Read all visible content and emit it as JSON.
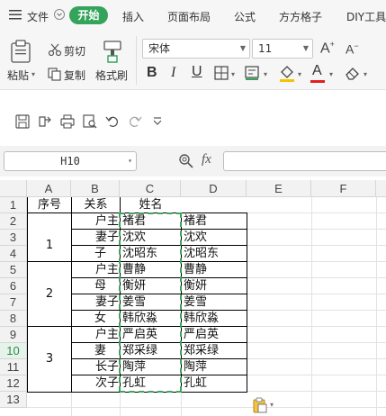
{
  "menu": {
    "file_label": "文件",
    "tabs": [
      "开始",
      "插入",
      "页面布局",
      "公式",
      "方方格子",
      "DIY工具"
    ]
  },
  "ribbon": {
    "paste_label": "粘贴",
    "cut_label": "剪切",
    "copy_label": "复制",
    "format_painter_label": "格式刷",
    "font_name": "宋体",
    "font_size": "11",
    "bold": "B",
    "italic": "I",
    "underline": "U",
    "font_color_letter": "A",
    "font_color": "#e02020",
    "fill_color": "#f5c400"
  },
  "formula_bar": {
    "name_box": "H10",
    "fx_label": "fx",
    "formula": ""
  },
  "sheet": {
    "columns": [
      "A",
      "B",
      "C",
      "D",
      "E",
      "F"
    ],
    "rows": [
      "1",
      "2",
      "3",
      "4",
      "5",
      "6",
      "7",
      "8",
      "9",
      "10",
      "11",
      "12",
      "13"
    ],
    "header_row": {
      "a": "序号",
      "b": "关系",
      "c": "姓名",
      "d": ""
    },
    "groups": [
      {
        "number": "1"
      },
      {
        "number": "2"
      },
      {
        "number": "3"
      }
    ],
    "relations": [
      "户主",
      "妻子",
      "子",
      "户主",
      "母",
      "妻子",
      "女",
      "户主",
      "妻",
      "长子",
      "次子"
    ],
    "names_c": [
      "褚君",
      "沈欢",
      "沈昭东",
      "曹静",
      "衡妍",
      "姜雪",
      "韩欣淼",
      "严启英",
      "郑采绿",
      "陶萍",
      "孔虹"
    ],
    "names_d": [
      "褚君",
      "沈欢",
      "沈昭东",
      "曹静",
      "衡妍",
      "姜雪",
      "韩欣淼",
      "严启英",
      "郑采绿",
      "陶萍",
      "孔虹"
    ],
    "selected_cell": "H10",
    "accent_color": "#33a45a"
  }
}
